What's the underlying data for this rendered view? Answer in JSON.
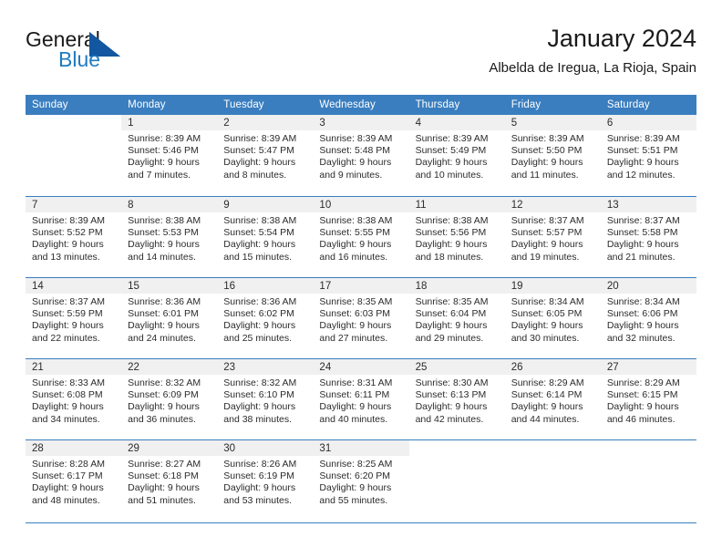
{
  "brand": {
    "word_one": "General",
    "word_two": "Blue",
    "triangle_icon": "blue-triangle-icon",
    "accent_color": "#1f7bc1"
  },
  "header": {
    "title": "January 2024",
    "subtitle": "Albelda de Iregua, La Rioja, Spain"
  },
  "theme": {
    "header_bg": "#3a7ebf",
    "daynum_band_bg": "#f0f0f0",
    "grid_line": "#3a7ebf",
    "text": "#2b2b2b"
  },
  "calendar": {
    "weekday_headers": [
      "Sunday",
      "Monday",
      "Tuesday",
      "Wednesday",
      "Thursday",
      "Friday",
      "Saturday"
    ],
    "weeks": [
      [
        {
          "day": "",
          "blank": true,
          "lines": []
        },
        {
          "day": "1",
          "lines": [
            "Sunrise: 8:39 AM",
            "Sunset: 5:46 PM",
            "Daylight: 9 hours",
            "and 7 minutes."
          ]
        },
        {
          "day": "2",
          "lines": [
            "Sunrise: 8:39 AM",
            "Sunset: 5:47 PM",
            "Daylight: 9 hours",
            "and 8 minutes."
          ]
        },
        {
          "day": "3",
          "lines": [
            "Sunrise: 8:39 AM",
            "Sunset: 5:48 PM",
            "Daylight: 9 hours",
            "and 9 minutes."
          ]
        },
        {
          "day": "4",
          "lines": [
            "Sunrise: 8:39 AM",
            "Sunset: 5:49 PM",
            "Daylight: 9 hours",
            "and 10 minutes."
          ]
        },
        {
          "day": "5",
          "lines": [
            "Sunrise: 8:39 AM",
            "Sunset: 5:50 PM",
            "Daylight: 9 hours",
            "and 11 minutes."
          ]
        },
        {
          "day": "6",
          "lines": [
            "Sunrise: 8:39 AM",
            "Sunset: 5:51 PM",
            "Daylight: 9 hours",
            "and 12 minutes."
          ]
        }
      ],
      [
        {
          "day": "7",
          "lines": [
            "Sunrise: 8:39 AM",
            "Sunset: 5:52 PM",
            "Daylight: 9 hours",
            "and 13 minutes."
          ]
        },
        {
          "day": "8",
          "lines": [
            "Sunrise: 8:38 AM",
            "Sunset: 5:53 PM",
            "Daylight: 9 hours",
            "and 14 minutes."
          ]
        },
        {
          "day": "9",
          "lines": [
            "Sunrise: 8:38 AM",
            "Sunset: 5:54 PM",
            "Daylight: 9 hours",
            "and 15 minutes."
          ]
        },
        {
          "day": "10",
          "lines": [
            "Sunrise: 8:38 AM",
            "Sunset: 5:55 PM",
            "Daylight: 9 hours",
            "and 16 minutes."
          ]
        },
        {
          "day": "11",
          "lines": [
            "Sunrise: 8:38 AM",
            "Sunset: 5:56 PM",
            "Daylight: 9 hours",
            "and 18 minutes."
          ]
        },
        {
          "day": "12",
          "lines": [
            "Sunrise: 8:37 AM",
            "Sunset: 5:57 PM",
            "Daylight: 9 hours",
            "and 19 minutes."
          ]
        },
        {
          "day": "13",
          "lines": [
            "Sunrise: 8:37 AM",
            "Sunset: 5:58 PM",
            "Daylight: 9 hours",
            "and 21 minutes."
          ]
        }
      ],
      [
        {
          "day": "14",
          "lines": [
            "Sunrise: 8:37 AM",
            "Sunset: 5:59 PM",
            "Daylight: 9 hours",
            "and 22 minutes."
          ]
        },
        {
          "day": "15",
          "lines": [
            "Sunrise: 8:36 AM",
            "Sunset: 6:01 PM",
            "Daylight: 9 hours",
            "and 24 minutes."
          ]
        },
        {
          "day": "16",
          "lines": [
            "Sunrise: 8:36 AM",
            "Sunset: 6:02 PM",
            "Daylight: 9 hours",
            "and 25 minutes."
          ]
        },
        {
          "day": "17",
          "lines": [
            "Sunrise: 8:35 AM",
            "Sunset: 6:03 PM",
            "Daylight: 9 hours",
            "and 27 minutes."
          ]
        },
        {
          "day": "18",
          "lines": [
            "Sunrise: 8:35 AM",
            "Sunset: 6:04 PM",
            "Daylight: 9 hours",
            "and 29 minutes."
          ]
        },
        {
          "day": "19",
          "lines": [
            "Sunrise: 8:34 AM",
            "Sunset: 6:05 PM",
            "Daylight: 9 hours",
            "and 30 minutes."
          ]
        },
        {
          "day": "20",
          "lines": [
            "Sunrise: 8:34 AM",
            "Sunset: 6:06 PM",
            "Daylight: 9 hours",
            "and 32 minutes."
          ]
        }
      ],
      [
        {
          "day": "21",
          "lines": [
            "Sunrise: 8:33 AM",
            "Sunset: 6:08 PM",
            "Daylight: 9 hours",
            "and 34 minutes."
          ]
        },
        {
          "day": "22",
          "lines": [
            "Sunrise: 8:32 AM",
            "Sunset: 6:09 PM",
            "Daylight: 9 hours",
            "and 36 minutes."
          ]
        },
        {
          "day": "23",
          "lines": [
            "Sunrise: 8:32 AM",
            "Sunset: 6:10 PM",
            "Daylight: 9 hours",
            "and 38 minutes."
          ]
        },
        {
          "day": "24",
          "lines": [
            "Sunrise: 8:31 AM",
            "Sunset: 6:11 PM",
            "Daylight: 9 hours",
            "and 40 minutes."
          ]
        },
        {
          "day": "25",
          "lines": [
            "Sunrise: 8:30 AM",
            "Sunset: 6:13 PM",
            "Daylight: 9 hours",
            "and 42 minutes."
          ]
        },
        {
          "day": "26",
          "lines": [
            "Sunrise: 8:29 AM",
            "Sunset: 6:14 PM",
            "Daylight: 9 hours",
            "and 44 minutes."
          ]
        },
        {
          "day": "27",
          "lines": [
            "Sunrise: 8:29 AM",
            "Sunset: 6:15 PM",
            "Daylight: 9 hours",
            "and 46 minutes."
          ]
        }
      ],
      [
        {
          "day": "28",
          "lines": [
            "Sunrise: 8:28 AM",
            "Sunset: 6:17 PM",
            "Daylight: 9 hours",
            "and 48 minutes."
          ]
        },
        {
          "day": "29",
          "lines": [
            "Sunrise: 8:27 AM",
            "Sunset: 6:18 PM",
            "Daylight: 9 hours",
            "and 51 minutes."
          ]
        },
        {
          "day": "30",
          "lines": [
            "Sunrise: 8:26 AM",
            "Sunset: 6:19 PM",
            "Daylight: 9 hours",
            "and 53 minutes."
          ]
        },
        {
          "day": "31",
          "lines": [
            "Sunrise: 8:25 AM",
            "Sunset: 6:20 PM",
            "Daylight: 9 hours",
            "and 55 minutes."
          ]
        },
        {
          "day": "",
          "blank": true,
          "lines": []
        },
        {
          "day": "",
          "blank": true,
          "lines": []
        },
        {
          "day": "",
          "blank": true,
          "lines": []
        }
      ]
    ]
  }
}
